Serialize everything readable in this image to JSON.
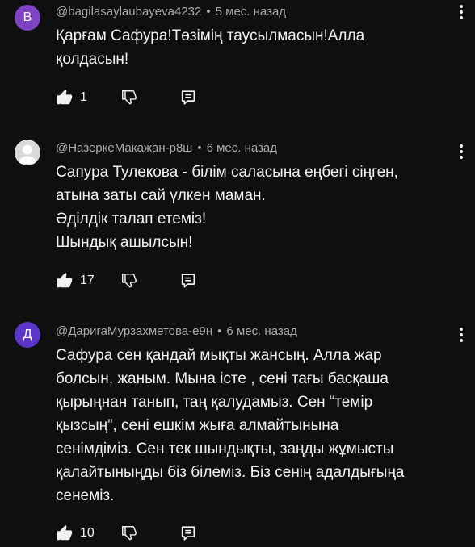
{
  "comments": [
    {
      "avatar_letter": "B",
      "avatar_color": "#7e44c4",
      "author": "@bagilasaylaubayeva4232",
      "time": "5 мес. назад",
      "lines": [
        "Қарғам Сафура!Төзімің таусылмасын!Алла",
        "қолдасын!"
      ],
      "likes": "1"
    },
    {
      "avatar_letter": "",
      "avatar_color": "#d9d9d9",
      "author": "@НазеркеМакажан-р8ш",
      "time": "6 мес. назад",
      "lines": [
        "Сапура Тулекова - білім саласына еңбегі сіңген,",
        "атына заты сай үлкен маман.",
        "Әділдік талап етеміз!",
        "Шындық ашылсын!"
      ],
      "likes": "17"
    },
    {
      "avatar_letter": "Д",
      "avatar_color": "#5c35c9",
      "author": "@ДаригаМурзахметова-е9н",
      "time": "6 мес. назад",
      "lines": [
        "Сафура сен қандай мықты жансың. Алла жар",
        "болсын, жаным. Мына істе , сені тағы басқаша",
        "қырыңнан танып, таң қалудамыз. Сен “темір",
        "қызсың”, сені ешкім жыға алмайтынына",
        "сенімдіміз. Сен тек шындықты, заңды жұмысты",
        "қалайтыныңды біз білеміз. Біз сенің адалдығыңа",
        "сенеміз."
      ],
      "likes": "10"
    }
  ],
  "icons": {
    "like": "thumb-up-icon",
    "dislike": "thumb-down-icon",
    "reply": "reply-icon",
    "menu": "more-vert-icon"
  }
}
